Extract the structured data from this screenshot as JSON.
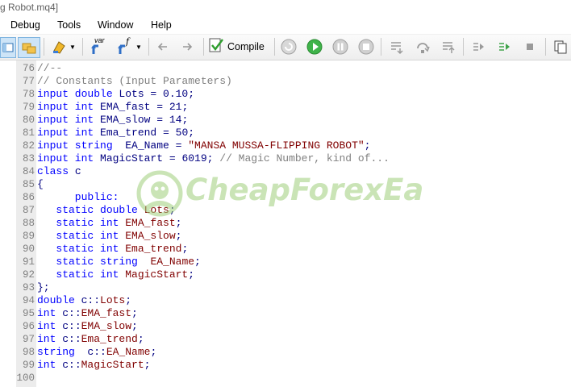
{
  "window": {
    "title": "g Robot.mq4]"
  },
  "menu": [
    "Debug",
    "Tools",
    "Window",
    "Help"
  ],
  "toolbar": {
    "compile_label": "Compile",
    "var_label": "var",
    "f_label": "f"
  },
  "watermark": {
    "text": "CheapForexEa"
  },
  "code": [
    {
      "n": "76",
      "parts": [
        [
          "cm",
          "//--"
        ]
      ]
    },
    {
      "n": "77",
      "parts": [
        [
          "cm",
          "// Constants (Input Parameters)"
        ]
      ]
    },
    {
      "n": "78",
      "parts": [
        [
          "kw",
          "input double "
        ],
        [
          "pl",
          "Lots = "
        ],
        [
          "nm",
          "0.10"
        ],
        [
          "pl",
          ";"
        ]
      ]
    },
    {
      "n": "79",
      "parts": [
        [
          "kw",
          "input int "
        ],
        [
          "pl",
          "EMA_fast = "
        ],
        [
          "nm",
          "21"
        ],
        [
          "pl",
          ";"
        ]
      ]
    },
    {
      "n": "80",
      "parts": [
        [
          "kw",
          "input int "
        ],
        [
          "pl",
          "EMA_slow = "
        ],
        [
          "nm",
          "14"
        ],
        [
          "pl",
          ";"
        ]
      ]
    },
    {
      "n": "81",
      "parts": [
        [
          "kw",
          "input int "
        ],
        [
          "pl",
          "Ema_trend = "
        ],
        [
          "nm",
          "50"
        ],
        [
          "pl",
          ";"
        ]
      ]
    },
    {
      "n": "82",
      "parts": [
        [
          "kw",
          "input string  "
        ],
        [
          "pl",
          "EA_Name = "
        ],
        [
          "st",
          "\"MANSA MUSSA-FLIPPING ROBOT\""
        ],
        [
          "pl",
          ";"
        ]
      ]
    },
    {
      "n": "83",
      "parts": [
        [
          "kw",
          "input int "
        ],
        [
          "pl",
          "MagicStart = "
        ],
        [
          "nm",
          "6019"
        ],
        [
          "pl",
          "; "
        ],
        [
          "cm",
          "// Magic Number, kind of..."
        ]
      ]
    },
    {
      "n": "84",
      "parts": [
        [
          "kw",
          "class "
        ],
        [
          "pl",
          "c"
        ]
      ]
    },
    {
      "n": "85",
      "parts": [
        [
          "pl",
          "{"
        ]
      ]
    },
    {
      "n": "86",
      "parts": [
        [
          "kw",
          "      public:"
        ]
      ]
    },
    {
      "n": "87",
      "parts": [
        [
          "kw",
          "   static double "
        ],
        [
          "id",
          "Lots"
        ],
        [
          "pl",
          ";"
        ]
      ]
    },
    {
      "n": "88",
      "parts": [
        [
          "kw",
          "   static int "
        ],
        [
          "id",
          "EMA_fast"
        ],
        [
          "pl",
          ";"
        ]
      ]
    },
    {
      "n": "89",
      "parts": [
        [
          "kw",
          "   static int "
        ],
        [
          "id",
          "EMA_slow"
        ],
        [
          "pl",
          ";"
        ]
      ]
    },
    {
      "n": "90",
      "parts": [
        [
          "kw",
          "   static int "
        ],
        [
          "id",
          "Ema_trend"
        ],
        [
          "pl",
          ";"
        ]
      ]
    },
    {
      "n": "91",
      "parts": [
        [
          "kw",
          "   static string  "
        ],
        [
          "id",
          "EA_Name"
        ],
        [
          "pl",
          ";"
        ]
      ]
    },
    {
      "n": "92",
      "parts": [
        [
          "kw",
          "   static int "
        ],
        [
          "id",
          "MagicStart"
        ],
        [
          "pl",
          ";"
        ]
      ]
    },
    {
      "n": "93",
      "parts": [
        [
          "pl",
          "};"
        ]
      ]
    },
    {
      "n": "94",
      "parts": [
        [
          "kw",
          "double "
        ],
        [
          "pl",
          "c::"
        ],
        [
          "id",
          "Lots"
        ],
        [
          "pl",
          ";"
        ]
      ]
    },
    {
      "n": "95",
      "parts": [
        [
          "kw",
          "int "
        ],
        [
          "pl",
          "c::"
        ],
        [
          "id",
          "EMA_fast"
        ],
        [
          "pl",
          ";"
        ]
      ]
    },
    {
      "n": "96",
      "parts": [
        [
          "kw",
          "int "
        ],
        [
          "pl",
          "c::"
        ],
        [
          "id",
          "EMA_slow"
        ],
        [
          "pl",
          ";"
        ]
      ]
    },
    {
      "n": "97",
      "parts": [
        [
          "kw",
          "int "
        ],
        [
          "pl",
          "c::"
        ],
        [
          "id",
          "Ema_trend"
        ],
        [
          "pl",
          ";"
        ]
      ]
    },
    {
      "n": "98",
      "parts": [
        [
          "kw",
          "string  "
        ],
        [
          "pl",
          "c::"
        ],
        [
          "id",
          "EA_Name"
        ],
        [
          "pl",
          ";"
        ]
      ]
    },
    {
      "n": "99",
      "parts": [
        [
          "kw",
          "int "
        ],
        [
          "pl",
          "c::"
        ],
        [
          "id",
          "MagicStart"
        ],
        [
          "pl",
          ";"
        ]
      ]
    },
    {
      "n": "100",
      "parts": []
    }
  ]
}
